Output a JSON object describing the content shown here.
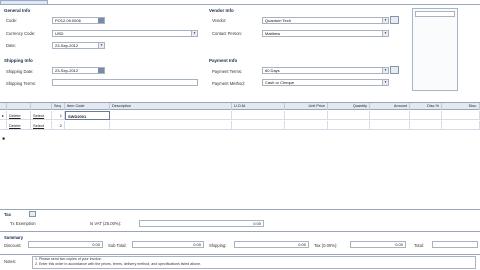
{
  "general_info": {
    "title": "General Info",
    "code_label": "Code:",
    "code_value": "PO12.09.0006",
    "currency_label": "Currency Code:",
    "currency_value": "USD",
    "date_label": "Date:",
    "date_value": "23-Sep-2012"
  },
  "vendor_info": {
    "title": "Vendor Info",
    "vendor_label": "Vendor:",
    "vendor_value": "Quantum Tech",
    "contact_label": "Contact Person:",
    "contact_value": "Matthew"
  },
  "shipping_info": {
    "title": "Shipping Info",
    "ship_date_label": "Shipping Date:",
    "ship_date_value": "23-Sep-2012",
    "ship_terms_label": "Shipping Terms:",
    "ship_terms_value": ""
  },
  "payment_info": {
    "title": "Payment Info",
    "terms_label": "Payment Terms:",
    "terms_value": "60 Days",
    "method_label": "Payment Method:",
    "method_value": "Cash or Cheque"
  },
  "grid": {
    "columns": [
      "",
      "",
      "",
      "Seq",
      "Item Code",
      "Description",
      "U.O.M.",
      "Unit Price",
      "Quantity",
      "Amount",
      "Disc %",
      "Disc."
    ],
    "rows": [
      {
        "c1": "Delete",
        "c2": "Select",
        "seq": "1",
        "item_code": "SWD2001"
      },
      {
        "c1": "Delete",
        "c2": "Select",
        "seq": "2",
        "item_code": ""
      }
    ]
  },
  "tax": {
    "title": "Tax",
    "exemption_label": "Tx Exemption",
    "vat_label": "Is VAT (25.00%):",
    "vat_value": "0.00"
  },
  "summary": {
    "title": "Summary",
    "discount_label": "Discount:",
    "discount_value": "0.00",
    "subtotal_label": "Sub Total:",
    "subtotal_value": "0.00",
    "shipping_label": "Shipping:",
    "shipping_value": "0.00",
    "tax_label": "Tax (0.00%):",
    "tax_value": "0.00",
    "total_label": "Total:",
    "total_value": ""
  },
  "notes": {
    "label": "Notes:",
    "line1": "1. Please send two copies of your invoice.",
    "line2": "2. Enter this order in accordance with the prices, terms, delivery method, and specifications listed above."
  },
  "colors": {
    "section_title": "#1a2a4a",
    "border": "#a8b3c2",
    "header_bg": "#e4e9f1"
  }
}
